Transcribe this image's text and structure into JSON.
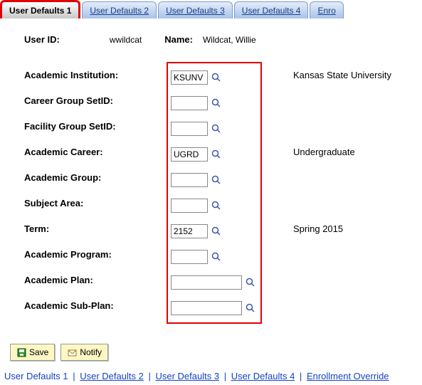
{
  "tabs": [
    {
      "label": "User Defaults 1",
      "active": true
    },
    {
      "label": "User Defaults 2",
      "active": false
    },
    {
      "label": "User Defaults 3",
      "active": false
    },
    {
      "label": "User Defaults 4",
      "active": false
    },
    {
      "label": "Enro",
      "active": false
    }
  ],
  "header": {
    "user_id_label": "User ID:",
    "user_id_value": "wwildcat",
    "name_label": "Name:",
    "name_value": "Wildcat, Willie"
  },
  "fields": [
    {
      "label": "Academic Institution:",
      "value": "KSUNV",
      "width": "short",
      "desc": "Kansas State University"
    },
    {
      "label": "Career Group SetID:",
      "value": "",
      "width": "short",
      "desc": ""
    },
    {
      "label": "Facility Group SetID:",
      "value": "",
      "width": "short",
      "desc": ""
    },
    {
      "label": "Academic Career:",
      "value": "UGRD",
      "width": "short",
      "desc": "Undergraduate"
    },
    {
      "label": "Academic Group:",
      "value": "",
      "width": "short",
      "desc": ""
    },
    {
      "label": "Subject Area:",
      "value": "",
      "width": "short",
      "desc": ""
    },
    {
      "label": "Term:",
      "value": "2152",
      "width": "short",
      "desc": "Spring 2015"
    },
    {
      "label": "Academic Program:",
      "value": "",
      "width": "short",
      "desc": ""
    },
    {
      "label": "Academic Plan:",
      "value": "",
      "width": "long",
      "desc": ""
    },
    {
      "label": "Academic Sub-Plan:",
      "value": "",
      "width": "long",
      "desc": ""
    }
  ],
  "buttons": {
    "save": "Save",
    "notify": "Notify"
  },
  "bottomLinks": {
    "current": "User Defaults 1",
    "links": [
      "User Defaults 2",
      "User Defaults 3",
      "User Defaults 4",
      "Enrollment Override"
    ],
    "sep": "|"
  }
}
